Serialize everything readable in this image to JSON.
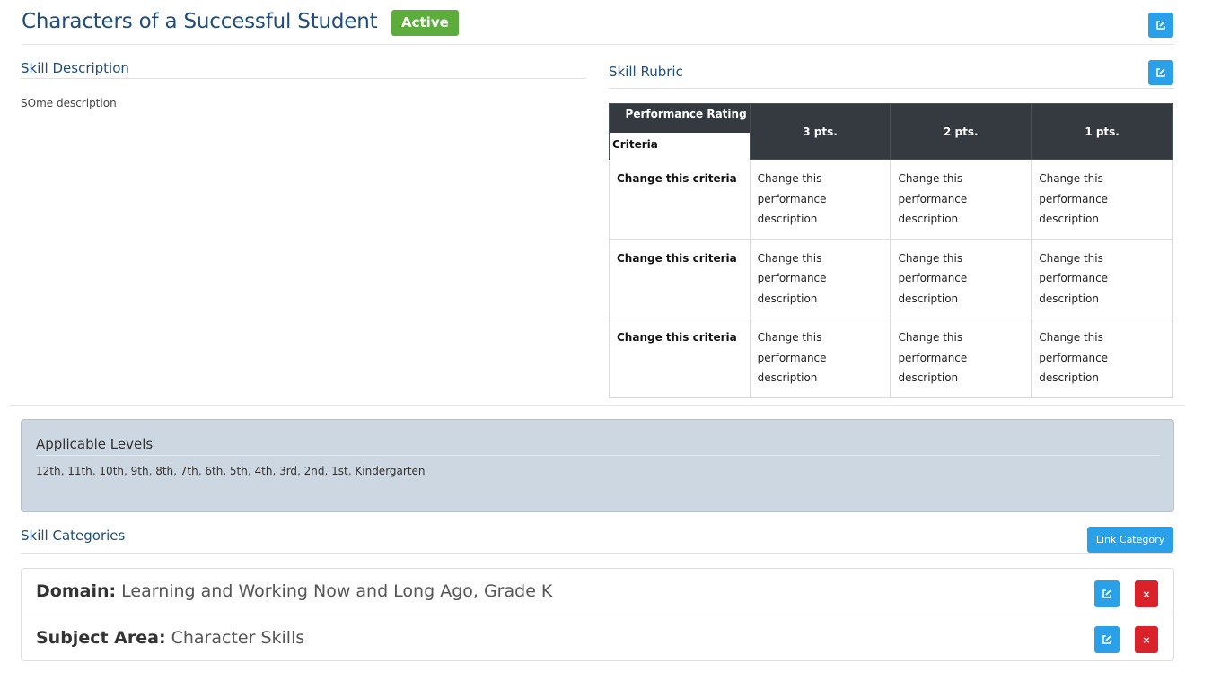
{
  "header": {
    "title": "Characters of a Successful Student",
    "status": "Active"
  },
  "description": {
    "heading": "Skill Description",
    "text": "SOme description"
  },
  "rubric": {
    "heading": "Skill Rubric",
    "corner_top": "Performance Rating",
    "corner_bottom": "Criteria",
    "columns": [
      "3 pts.",
      "2 pts.",
      "1 pts."
    ],
    "rows": [
      {
        "criteria": "Change this criteria",
        "cells": [
          "Change this performance description",
          "Change this performance description",
          "Change this performance description"
        ]
      },
      {
        "criteria": "Change this criteria",
        "cells": [
          "Change this performance description",
          "Change this performance description",
          "Change this performance description"
        ]
      },
      {
        "criteria": "Change this criteria",
        "cells": [
          "Change this performance description",
          "Change this performance description",
          "Change this performance description"
        ]
      }
    ]
  },
  "levels": {
    "heading": "Applicable Levels",
    "text": "12th, 11th, 10th, 9th, 8th, 7th, 6th, 5th, 4th, 3rd, 2nd, 1st, Kindergarten"
  },
  "categories": {
    "heading": "Skill Categories",
    "link_label": "Link Category",
    "items": [
      {
        "label": "Domain:",
        "value": " Learning and Working Now and Long Ago, Grade K"
      },
      {
        "label": "Subject Area:",
        "value": " Character Skills"
      }
    ],
    "delete_glyph": "×"
  },
  "colors": {
    "accent": "#2aa0e8",
    "title": "#1f4e7a",
    "badge": "#5cad3b",
    "danger": "#d9222a",
    "table_header": "#343a40",
    "levels_panel": "#cdd7e1"
  },
  "icons": {
    "edit": "edit-icon",
    "delete": "close-icon"
  }
}
